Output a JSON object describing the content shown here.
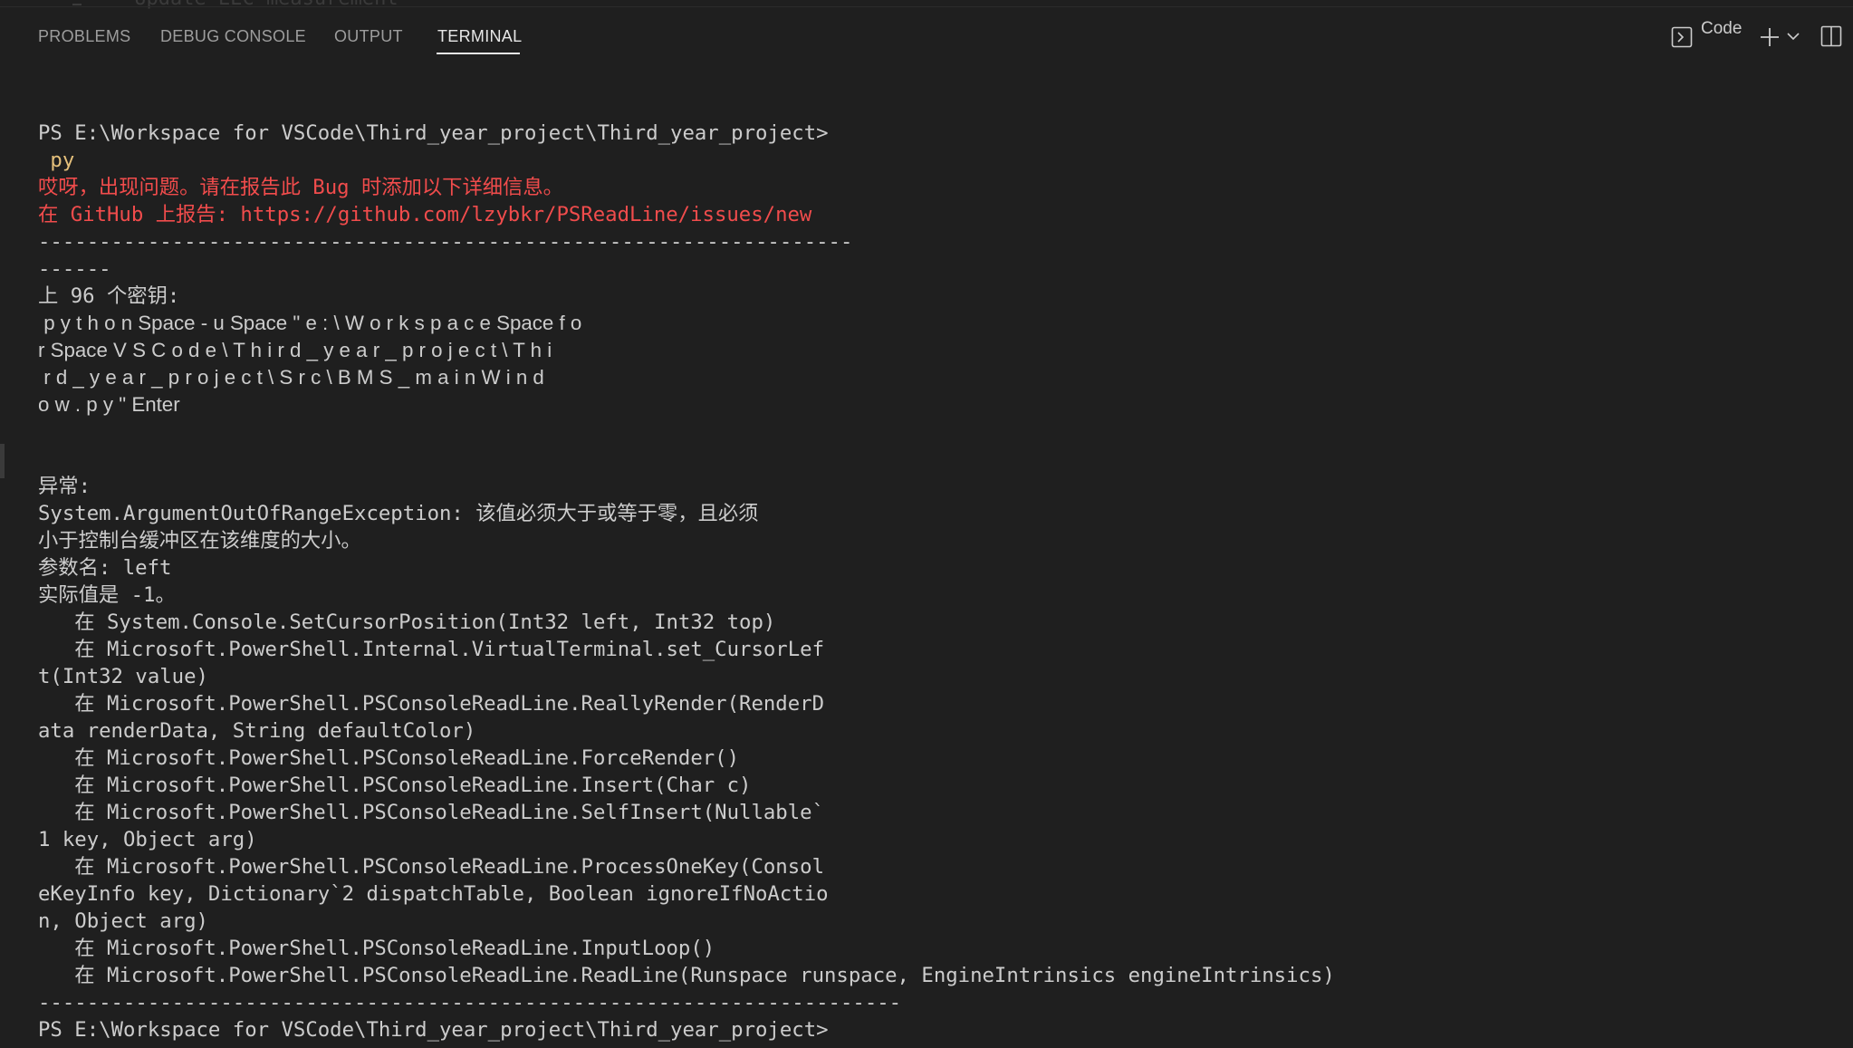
{
  "editor_ghost": {
    "text": "*Update EEC measurement"
  },
  "tabs": [
    {
      "label": "PROBLEMS",
      "active": false
    },
    {
      "label": "DEBUG CONSOLE",
      "active": false
    },
    {
      "label": "OUTPUT",
      "active": false
    },
    {
      "label": "TERMINAL",
      "active": true
    }
  ],
  "actions": {
    "shell_label": "Code",
    "icons": [
      "terminal-icon",
      "plus-icon",
      "chevron-down-icon",
      "split-panel-icon"
    ]
  },
  "colors": {
    "background": "#1f1f1f",
    "text": "#cccccc",
    "error": "#f14c4c",
    "command": "#e5c07b"
  },
  "terminal": {
    "lines": [
      {
        "text": "",
        "color": "default"
      },
      {
        "text": "PS E:\\Workspace for VSCode\\Third_year_project\\Third_year_project>",
        "color": "default"
      },
      {
        "text": " py",
        "color": "yellow"
      },
      {
        "text": "哎呀，出现问题。请在报告此 Bug 时添加以下详细信息。",
        "color": "red"
      },
      {
        "text": "在 GitHub 上报告: https://github.com/lzybkr/PSReadLine/issues/new",
        "color": "red"
      },
      {
        "text": "-------------------------------------------------------------------",
        "color": "default"
      },
      {
        "text": "------",
        "color": "default"
      },
      {
        "text": "上 96 个密钥:",
        "color": "default"
      },
      {
        "text": " p y t h o n Space - u Space \" e : \\ W o r k s p a c e Space f o",
        "color": "default",
        "font": "keys"
      },
      {
        "text": "r Space V S C o d e \\ T h i r d _ y e a r _ p r o j e c t \\ T h i",
        "color": "default",
        "font": "keys"
      },
      {
        "text": " r d _ y e a r _ p r o j e c t \\ S r c \\ B M S _ m a i n W i n d",
        "color": "default",
        "font": "keys"
      },
      {
        "text": "o w . p y \" Enter",
        "color": "default",
        "font": "keys"
      },
      {
        "text": "",
        "color": "default"
      },
      {
        "text": "",
        "color": "default"
      },
      {
        "text": "异常:",
        "color": "default"
      },
      {
        "text": "System.ArgumentOutOfRangeException: 该值必须大于或等于零，且必须",
        "color": "default"
      },
      {
        "text": "小于控制台缓冲区在该维度的大小。",
        "color": "default"
      },
      {
        "text": "参数名: left",
        "color": "default"
      },
      {
        "text": "实际值是 -1。",
        "color": "default"
      },
      {
        "text": "   在 System.Console.SetCursorPosition(Int32 left, Int32 top)",
        "color": "default"
      },
      {
        "text": "   在 Microsoft.PowerShell.Internal.VirtualTerminal.set_CursorLef",
        "color": "default"
      },
      {
        "text": "t(Int32 value)",
        "color": "default"
      },
      {
        "text": "   在 Microsoft.PowerShell.PSConsoleReadLine.ReallyRender(RenderD",
        "color": "default"
      },
      {
        "text": "ata renderData, String defaultColor)",
        "color": "default"
      },
      {
        "text": "   在 Microsoft.PowerShell.PSConsoleReadLine.ForceRender()",
        "color": "default"
      },
      {
        "text": "   在 Microsoft.PowerShell.PSConsoleReadLine.Insert(Char c)",
        "color": "default"
      },
      {
        "text": "   在 Microsoft.PowerShell.PSConsoleReadLine.SelfInsert(Nullable`",
        "color": "default"
      },
      {
        "text": "1 key, Object arg)",
        "color": "default"
      },
      {
        "text": "   在 Microsoft.PowerShell.PSConsoleReadLine.ProcessOneKey(Consol",
        "color": "default"
      },
      {
        "text": "eKeyInfo key, Dictionary`2 dispatchTable, Boolean ignoreIfNoActio",
        "color": "default"
      },
      {
        "text": "n, Object arg)",
        "color": "default"
      },
      {
        "text": "   在 Microsoft.PowerShell.PSConsoleReadLine.InputLoop()",
        "color": "default"
      },
      {
        "text": "   在 Microsoft.PowerShell.PSConsoleReadLine.ReadLine(Runspace runspace, EngineIntrinsics engineIntrinsics)",
        "color": "default"
      },
      {
        "text": "-----------------------------------------------------------------------",
        "color": "default"
      },
      {
        "text": "PS E:\\Workspace for VSCode\\Third_year_project\\Third_year_project>",
        "color": "default"
      }
    ]
  }
}
